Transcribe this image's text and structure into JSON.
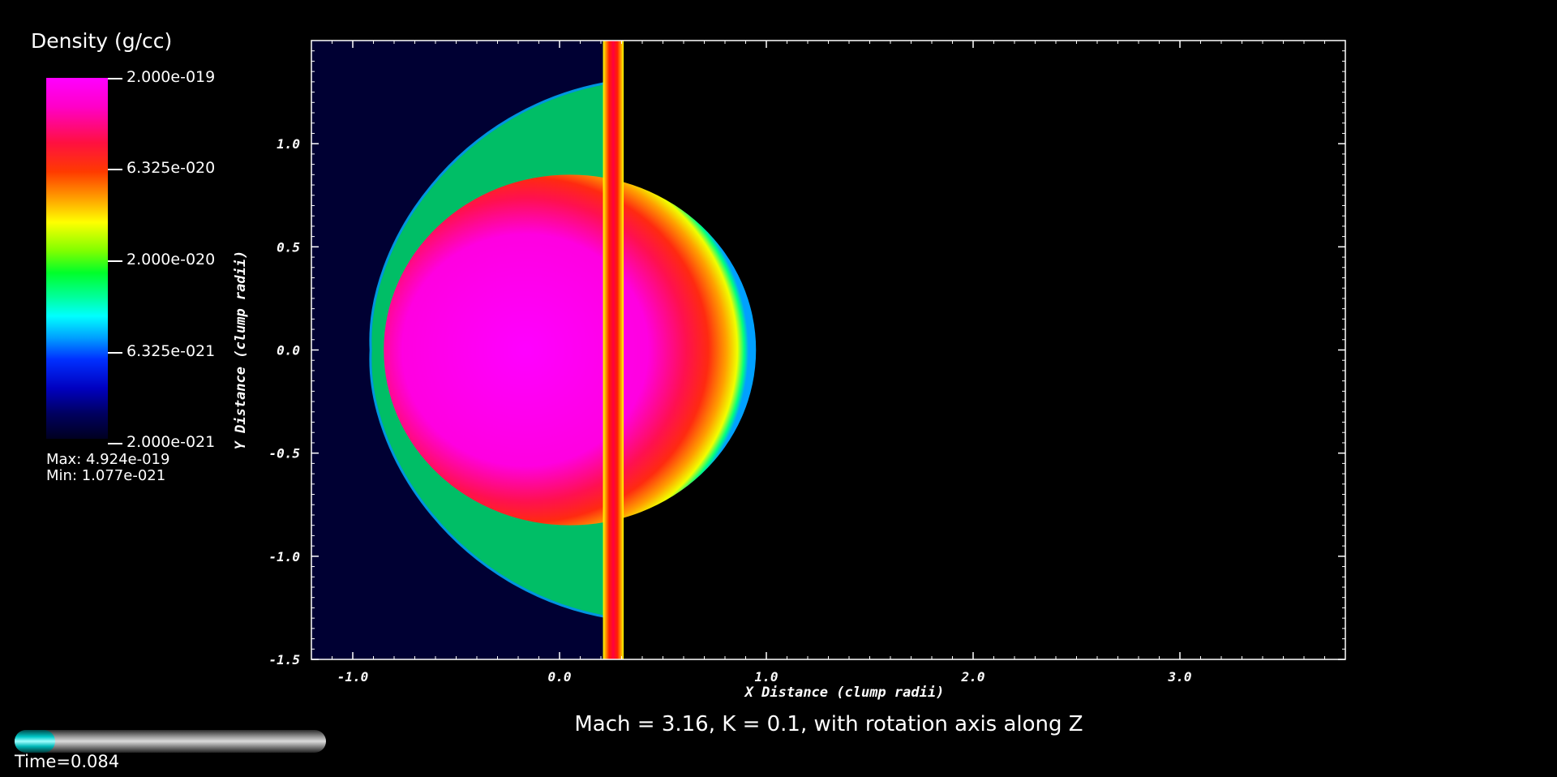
{
  "legend": {
    "title": "Density (g/cc)",
    "ticks": [
      "2.000e-019",
      "6.325e-020",
      "2.000e-020",
      "6.325e-021",
      "2.000e-021"
    ],
    "max_label": "Max:  4.924e-019",
    "min_label": "Min:  1.077e-021"
  },
  "caption": "Mach = 3.16, K = 0.1, with rotation axis along Z",
  "time": {
    "label": "Time=0.084",
    "progress": 0.13
  },
  "colors": {
    "background": "#000000",
    "ambient": "#000033",
    "peak": "#ff00ff",
    "slider_fill": "#00c8c8"
  },
  "chart_data": {
    "type": "heatmap",
    "title": "",
    "xlabel": "X Distance (clump radii)",
    "ylabel": "Y Distance (clump radii)",
    "xlim": [
      -1.2,
      3.8
    ],
    "ylim": [
      -1.5,
      1.5
    ],
    "xticks": [
      -1.0,
      0.0,
      1.0,
      2.0,
      3.0
    ],
    "xtick_labels": [
      "-1.0",
      "0.0",
      "1.0",
      "2.0",
      "3.0"
    ],
    "yticks": [
      -1.5,
      -1.0,
      -0.5,
      0.0,
      0.5,
      1.0
    ],
    "ytick_labels": [
      "-1.5",
      "-1.0",
      "-0.5",
      "0.0",
      "0.5",
      "1.0"
    ],
    "ambient_region": {
      "x": [
        -1.2,
        0.25
      ]
    },
    "clump": {
      "center": [
        0.05,
        0.0
      ],
      "rx": 0.9,
      "ry": 0.85
    },
    "vertical_filament": {
      "x": 0.26,
      "width": 0.1
    }
  }
}
